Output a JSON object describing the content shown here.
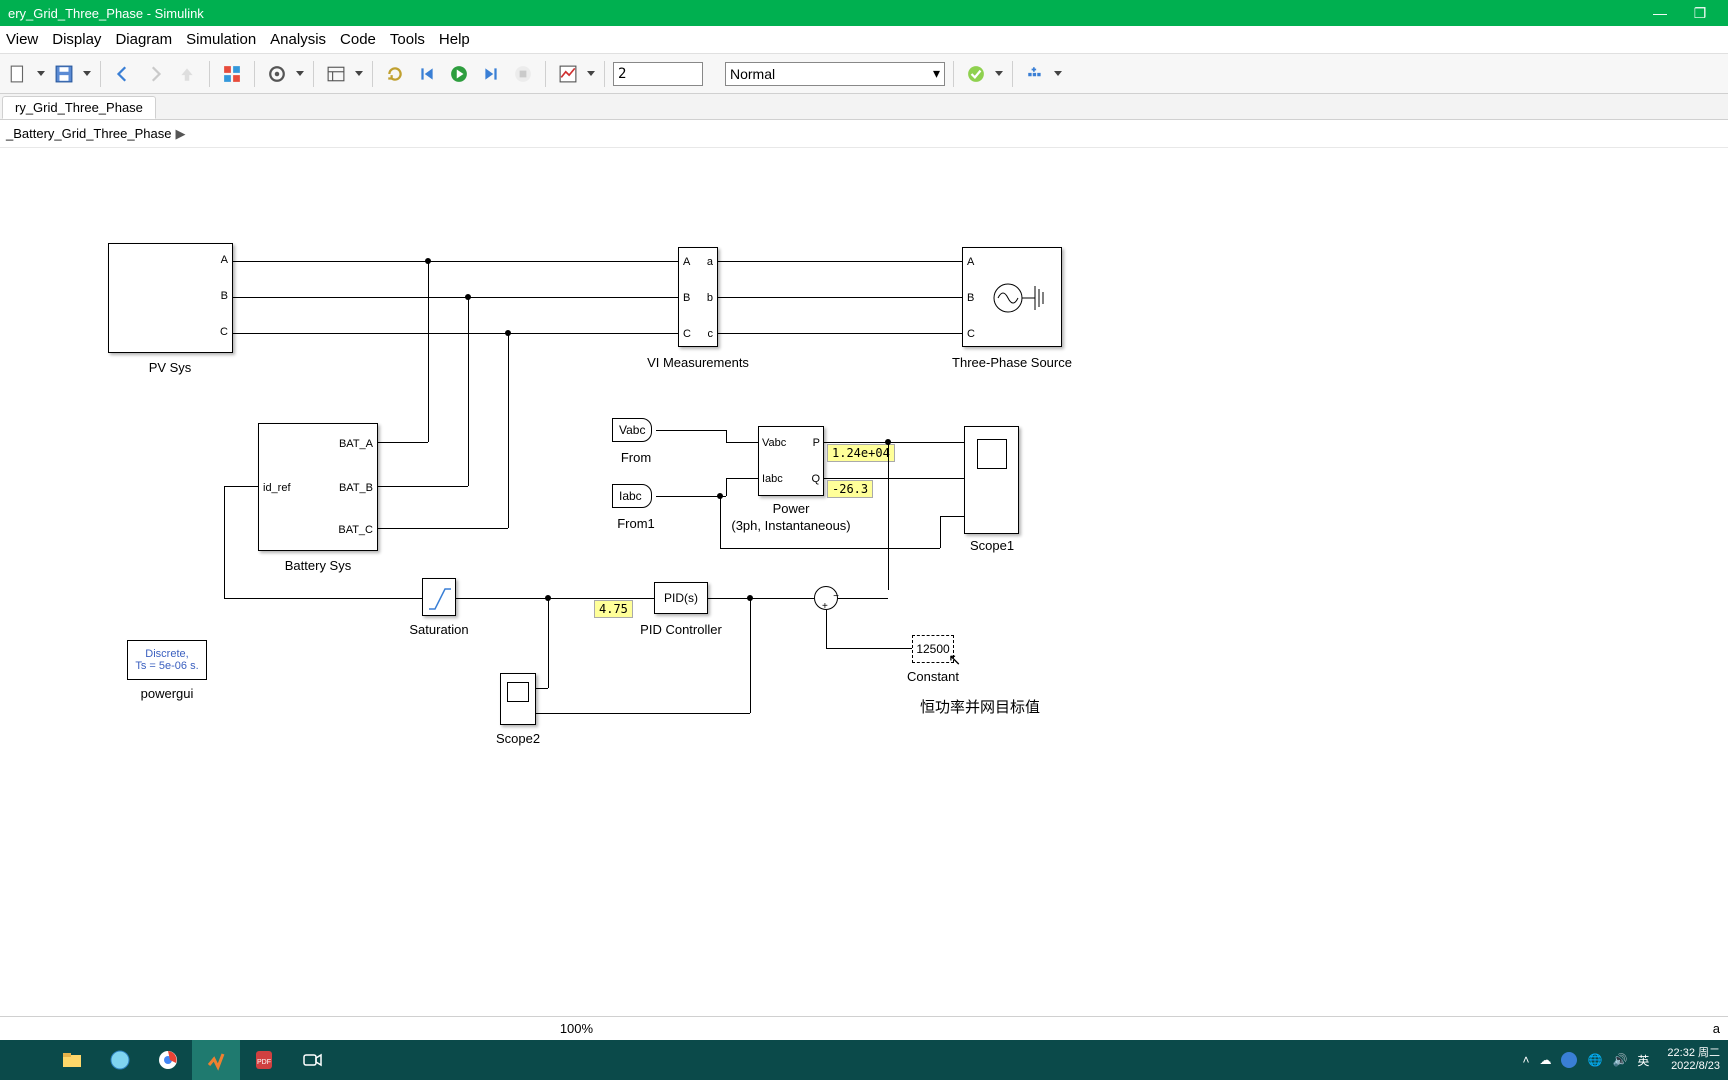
{
  "window": {
    "title": "ery_Grid_Three_Phase - Simulink"
  },
  "menu": {
    "view": "View",
    "display": "Display",
    "diagram": "Diagram",
    "simulation": "Simulation",
    "analysis": "Analysis",
    "code": "Code",
    "tools": "Tools",
    "help": "Help"
  },
  "toolbar": {
    "stop_time": "2",
    "mode": "Normal"
  },
  "tab": {
    "name": "ry_Grid_Three_Phase"
  },
  "breadcrumb": {
    "root": "_Battery_Grid_Three_Phase"
  },
  "blocks": {
    "pvsys": {
      "label": "PV Sys",
      "ports": {
        "a": "A",
        "b": "B",
        "c": "C"
      }
    },
    "battery": {
      "label": "Battery Sys",
      "ports": {
        "idref": "id_ref",
        "a": "BAT_A",
        "b": "BAT_B",
        "c": "BAT_C"
      }
    },
    "vimeas": {
      "label": "VI Measurements",
      "ports": {
        "Al": "A",
        "Bl": "B",
        "Cl": "C",
        "ar": "a",
        "br": "b",
        "cr": "c"
      }
    },
    "source": {
      "label": "Three-Phase Source",
      "ports": {
        "a": "A",
        "b": "B",
        "c": "C"
      }
    },
    "from1": {
      "tag": "Vabc",
      "label": "From"
    },
    "from2": {
      "tag": "Iabc",
      "label": "From1"
    },
    "power": {
      "label1": "Power",
      "label2": "(3ph, Instantaneous)",
      "ports": {
        "v": "Vabc",
        "i": "Iabc",
        "p": "P",
        "q": "Q"
      }
    },
    "p_val": "1.24e+04",
    "q_val": "-26.3",
    "scope1": {
      "label": "Scope1"
    },
    "sat": {
      "label": "Saturation"
    },
    "pid": {
      "text": "PID(s)",
      "label": "PID Controller"
    },
    "pid_val": "4.75",
    "sum": {
      "label": ""
    },
    "const": {
      "value": "12500",
      "label": "Constant"
    },
    "anno": "恒功率并网目标值",
    "scope2": {
      "label": "Scope2"
    },
    "powergui": {
      "line1": "Discrete,",
      "line2": "Ts = 5e-06 s.",
      "label": "powergui"
    }
  },
  "status": {
    "zoom": "100%",
    "right": "a"
  },
  "taskbar": {
    "ime": "英",
    "time": "22:32",
    "day": "周二",
    "date": "2022/8/23"
  }
}
